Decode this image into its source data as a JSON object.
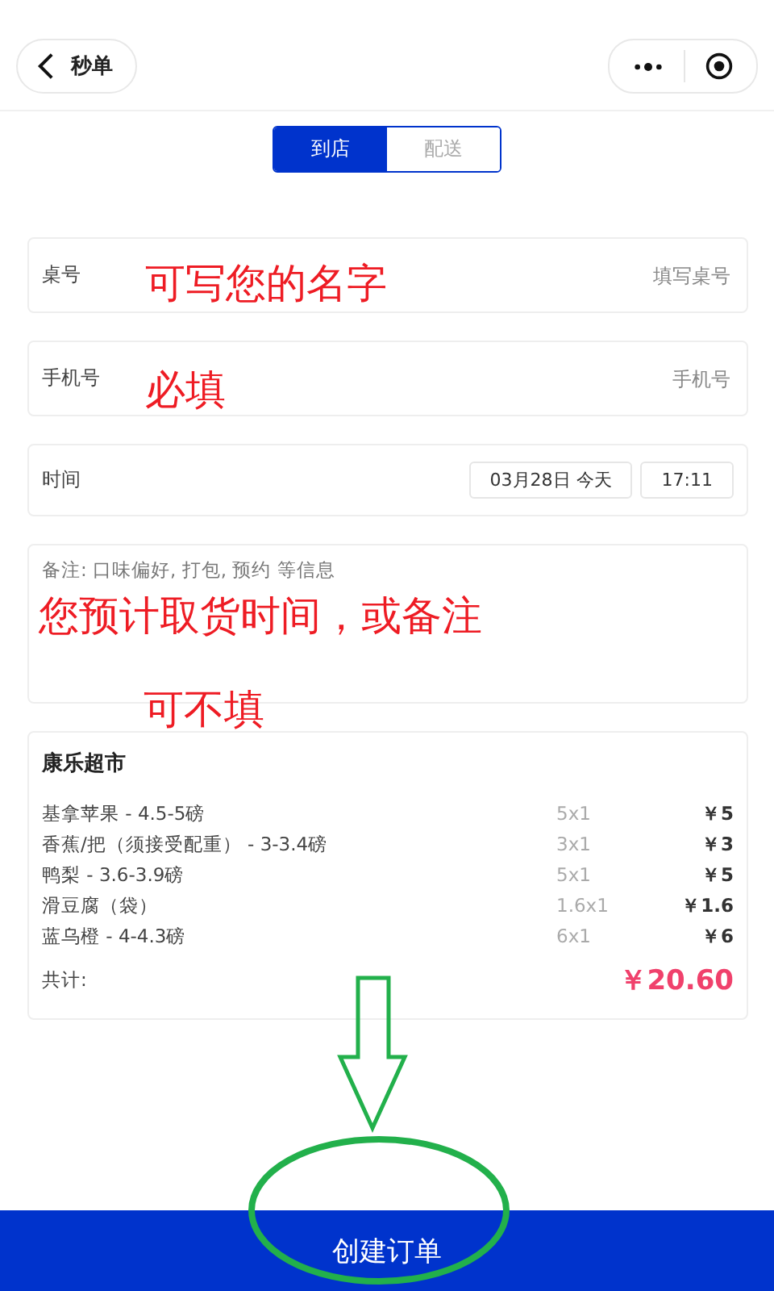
{
  "header": {
    "back_label": "秒单"
  },
  "tabs": [
    {
      "label": "到店",
      "selected": true
    },
    {
      "label": "配送",
      "selected": false
    }
  ],
  "fields": [
    {
      "kind": "input",
      "label": "桌号",
      "placeholder": "填写桌号",
      "annotation": "可写您的名字"
    },
    {
      "kind": "input",
      "label": "手机号",
      "placeholder": "手机号",
      "annotation": "必填"
    },
    {
      "kind": "time",
      "label": "时间",
      "date": "03月28日 今天",
      "time": "17:11"
    }
  ],
  "note": {
    "placeholder": "备注: 口味偏好, 打包, 预约 等信息",
    "annotations": [
      "您预计取货时间，或备注",
      "可不填"
    ]
  },
  "order": {
    "store": "康乐超市",
    "items": [
      {
        "name": "基拿苹果 - 4.5-5磅",
        "qty": "5x1",
        "price": "￥5"
      },
      {
        "name": "香蕉/把（须接受配重） - 3-3.4磅",
        "qty": "3x1",
        "price": "￥3"
      },
      {
        "name": "鸭梨 - 3.6-3.9磅",
        "qty": "5x1",
        "price": "￥5"
      },
      {
        "name": "滑豆腐（袋）",
        "qty": "1.6x1",
        "price": "￥1.6"
      },
      {
        "name": "蓝乌橙 - 4-4.3磅",
        "qty": "6x1",
        "price": "￥6"
      }
    ],
    "total_label": "共计:",
    "total": "￥20.60"
  },
  "submit_button": "创建订单"
}
